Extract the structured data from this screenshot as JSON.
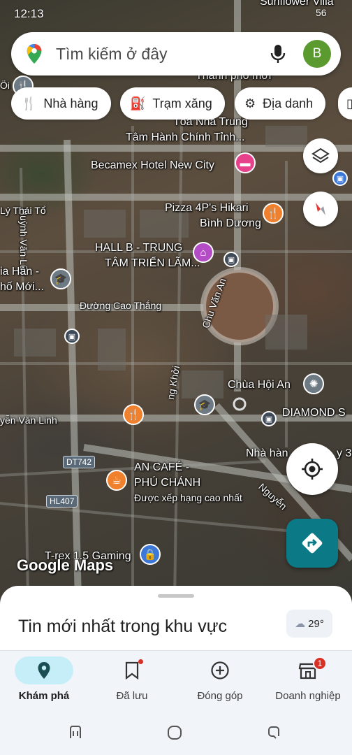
{
  "status_bar": {
    "time": "12:13",
    "battery": "56"
  },
  "search": {
    "placeholder": "Tìm kiếm ở đây",
    "avatar_letter": "B"
  },
  "chips": [
    {
      "label": "Nhà hàng",
      "icon": "restaurant-icon"
    },
    {
      "label": "Trạm xăng",
      "icon": "gas-station-icon"
    },
    {
      "label": "Địa danh",
      "icon": "landmark-icon"
    }
  ],
  "map": {
    "labels": [
      "Sunflower Villa",
      "Thành phố mới",
      "Tòa Nhà Trung",
      "Tâm Hành Chính Tỉnh...",
      "Becamex Hotel New City",
      "Pizza 4P's Hikari",
      "Bình Dương",
      "HALL B - TRUNG",
      "TÂM TRIỂN LÃM...",
      "Huỳnh Văn Lũy",
      "Lý Thái Tổ",
      "ia Hân -",
      "hố Mới...",
      "Đường Cao Thắng",
      "Chu Văn An",
      "Chùa Hội An",
      "DIAMOND S",
      "Nhà hàn",
      "y 3",
      "yễn Văn Linh",
      "AN CAFÉ -",
      "PHÚ CHÁNH",
      "Được xếp hạng cao nhất",
      "T-rex 1.5 Gaming",
      "Nguyễn",
      "ng Khởi",
      "Thành phố",
      "Öi"
    ],
    "road_tags": [
      "DT742",
      "HL407"
    ],
    "attribution": "Google Maps"
  },
  "sheet": {
    "title": "Tin mới nhất trong khu vực",
    "temperature": "29°"
  },
  "nav": [
    {
      "label": "Khám phá",
      "icon": "explore-pin-icon",
      "active": true
    },
    {
      "label": "Đã lưu",
      "icon": "bookmark-icon",
      "active": false
    },
    {
      "label": "Đóng góp",
      "icon": "add-circle-icon",
      "active": false
    },
    {
      "label": "Doanh nghiệp",
      "icon": "store-icon",
      "active": false,
      "badge": "1"
    }
  ],
  "colors": {
    "accent": "#0b7a86",
    "active_pill": "#c6eef8",
    "avatar": "#5b9a2e",
    "badge": "#d93025"
  }
}
